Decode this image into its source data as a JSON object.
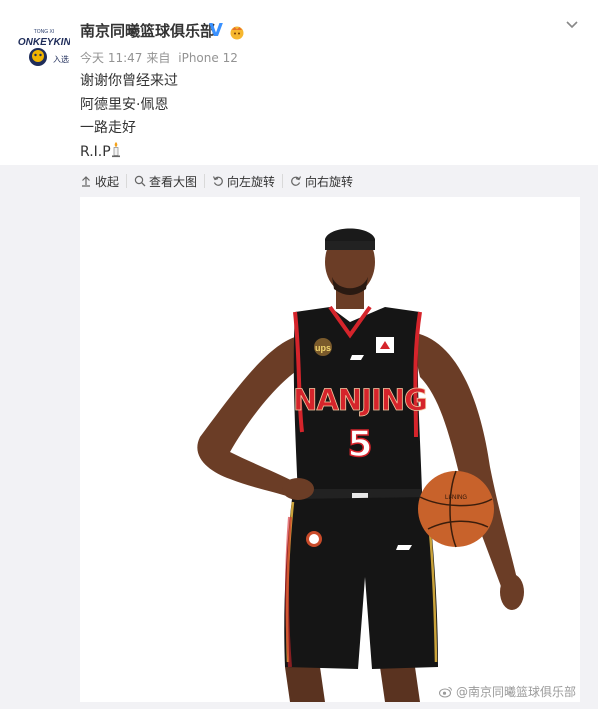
{
  "post": {
    "author": "南京同曦篮球俱乐部",
    "verified": "V",
    "time": "今天 11:47",
    "source_prefix": "来自",
    "source": "iPhone 12",
    "lines": [
      "谢谢你曾经来过",
      "阿德里安·佩恩",
      "一路走好",
      "R.I.P"
    ]
  },
  "toolbar": {
    "collapse": "收起",
    "view_large": "查看大图",
    "rotate_left": "向左旋转",
    "rotate_right": "向右旋转"
  },
  "photo": {
    "jersey_text": "NANJING",
    "jersey_number": "5",
    "patch": "ups",
    "watermark": "@南京同曦篮球俱乐部"
  },
  "colors": {
    "accent_blue": "#3a91ff",
    "jersey": "#151515",
    "trim_red": "#d5242b",
    "trim_gold": "#c9a23a"
  }
}
